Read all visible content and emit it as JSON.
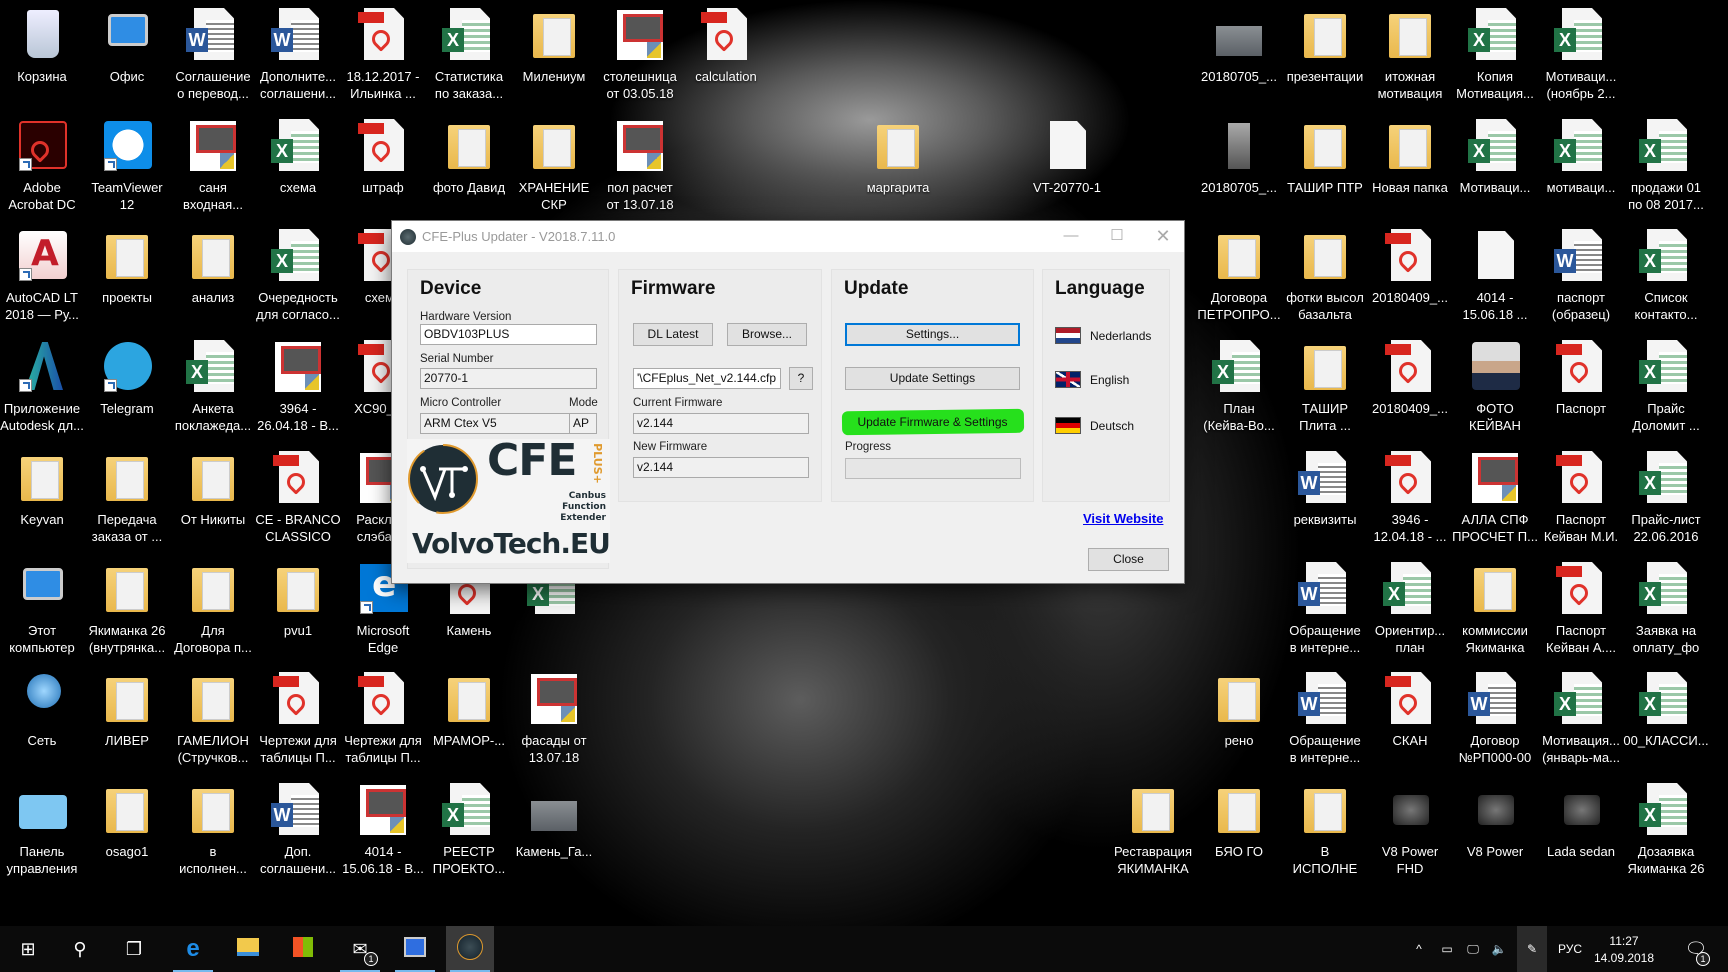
{
  "desktop": {
    "left_columns": [
      [
        {
          "label": "Корзина",
          "type": "recycle"
        },
        {
          "label": "Adobe\nAcrobat DC",
          "type": "acrobat-app"
        },
        {
          "label": "AutoCAD LT\n2018 — Ру...",
          "type": "autocad-app"
        },
        {
          "label": "Приложение\nAutodesk дл...",
          "type": "autodesk-app"
        },
        {
          "label": "Keyvan",
          "type": "user-folder"
        },
        {
          "label": "Этот\nкомпьютер",
          "type": "computer"
        },
        {
          "label": "Сеть",
          "type": "network"
        },
        {
          "label": "Панель\nуправления",
          "type": "control-panel"
        }
      ],
      [
        {
          "label": "Офис",
          "type": "office-app"
        },
        {
          "label": "TeamViewer\n12",
          "type": "teamviewer-app"
        },
        {
          "label": "проекты",
          "type": "folder"
        },
        {
          "label": "Telegram",
          "type": "telegram-app"
        },
        {
          "label": "Передача\nзаказа от ...",
          "type": "folder"
        },
        {
          "label": "Якиманка 26\n(внутрянка...",
          "type": "folder"
        },
        {
          "label": "ЛИВЕР",
          "type": "folder"
        },
        {
          "label": "osago1",
          "type": "folder"
        }
      ],
      [
        {
          "label": "Соглашение\nо перевод...",
          "type": "word"
        },
        {
          "label": "саня\nвходная...",
          "type": "dwg"
        },
        {
          "label": "анализ",
          "type": "folder"
        },
        {
          "label": "Анкета\nпоклажеда...",
          "type": "excel"
        },
        {
          "label": "От Никиты",
          "type": "folder"
        },
        {
          "label": "Для\nДоговора п...",
          "type": "folder"
        },
        {
          "label": "ГАМЕЛИОН\n(Стручков...",
          "type": "folder"
        },
        {
          "label": "в\nисполнен...",
          "type": "folder"
        }
      ],
      [
        {
          "label": "Дополните...\nсоглашени...",
          "type": "word"
        },
        {
          "label": "схема",
          "type": "excel"
        },
        {
          "label": "Очередность\nдля согласо...",
          "type": "excel"
        },
        {
          "label": "3964 -\n26.04.18 - В...",
          "type": "dwg"
        },
        {
          "label": "CE - BRANCO\nCLASSICO",
          "type": "pdf"
        },
        {
          "label": "pvu1",
          "type": "folder"
        },
        {
          "label": "Чертежи для\nтаблицы П...",
          "type": "pdf"
        },
        {
          "label": "Доп.\nсоглашени...",
          "type": "word"
        }
      ],
      [
        {
          "label": "18.12.2017 -\nИльинка ...",
          "type": "pdf"
        },
        {
          "label": "штраф",
          "type": "pdf"
        },
        {
          "label": "схема",
          "type": "pdf"
        },
        {
          "label": "XC90_o...",
          "type": "pdf"
        },
        {
          "label": "Раскла...\nслэбах...",
          "type": "dwg"
        },
        {
          "label": "Microsoft\nEdge",
          "type": "edge-app"
        },
        {
          "label": "Чертежи для\nтаблицы П...",
          "type": "pdf"
        },
        {
          "label": "4014 -\n15.06.18 - В...",
          "type": "dwg"
        }
      ],
      [
        {
          "label": "Статистика\nпо заказа...",
          "type": "excel"
        },
        {
          "label": "фото Давид",
          "type": "folder"
        },
        null,
        null,
        null,
        {
          "label": "Камень",
          "type": "pdf"
        },
        {
          "label": "МРАМОР-...",
          "type": "folder"
        },
        {
          "label": "РЕЕСТР\nПРОЕКТО...",
          "type": "excel"
        }
      ],
      [
        {
          "label": "Милениум",
          "type": "folder"
        },
        {
          "label": "ХРАНЕНИЕ\nСКР",
          "type": "folder"
        },
        null,
        null,
        null,
        {
          "label": "",
          "type": "excel"
        },
        {
          "label": "фасады от\n13.07.18",
          "type": "dwg"
        },
        {
          "label": "Камень_Га...",
          "type": "image"
        }
      ],
      [
        {
          "label": "столешница\nот 03.05.18",
          "type": "dwg"
        },
        {
          "label": "пол расчет\nот 13.07.18",
          "type": "dwg"
        }
      ],
      [
        {
          "label": "calculation",
          "type": "pdf"
        }
      ]
    ],
    "middle_icons": [
      {
        "label": "маргарита",
        "type": "folder"
      },
      {
        "label": "VT-20770-1",
        "type": "blank"
      }
    ],
    "right_columns": [
      [
        null,
        null,
        null,
        null,
        null,
        null,
        null,
        {
          "label": "Реставрация\nЯКИМАНКА",
          "type": "folder"
        }
      ],
      [
        {
          "label": "20180705_...",
          "type": "image"
        },
        {
          "label": "20180705_...",
          "type": "image-tall"
        },
        {
          "label": "Договора\nПЕТРОПРО...",
          "type": "folder"
        },
        {
          "label": "План\n(Кейва-Во...",
          "type": "excel"
        },
        null,
        null,
        {
          "label": "рено",
          "type": "folder"
        },
        {
          "label": "БЯО ГО",
          "type": "folder"
        }
      ],
      [
        {
          "label": "презентации",
          "type": "folder"
        },
        {
          "label": "ТАШИР ПТР",
          "type": "folder"
        },
        {
          "label": "фотки высол\nбазальта",
          "type": "folder"
        },
        {
          "label": "ТАШИР\nПлита ...",
          "type": "folder"
        },
        {
          "label": "реквизиты",
          "type": "word"
        },
        {
          "label": "Обращение\nв интерне...",
          "type": "word"
        },
        {
          "label": "Обращение\nв интерне...",
          "type": "word"
        },
        {
          "label": "В\nИСПОЛНЕ",
          "type": "folder"
        }
      ],
      [
        {
          "label": "итожная\nмотивация",
          "type": "folder"
        },
        {
          "label": "Новая папка",
          "type": "folder"
        },
        {
          "label": "20180409_...",
          "type": "pdf"
        },
        {
          "label": "20180409_...",
          "type": "pdf"
        },
        {
          "label": "3946 -\n12.04.18 - ...",
          "type": "pdf"
        },
        {
          "label": "Ориентир...\nплан",
          "type": "excel"
        },
        {
          "label": "СКАН",
          "type": "pdf"
        },
        {
          "label": "V8 Power\nFHD",
          "type": "video"
        }
      ],
      [
        {
          "label": "Копия\nМотивация...",
          "type": "excel"
        },
        {
          "label": "Мотиваци...",
          "type": "excel"
        },
        {
          "label": "4014 -\n15.06.18 ...",
          "type": "blank"
        },
        {
          "label": "ФОТО\nКЕЙВАН",
          "type": "photo"
        },
        {
          "label": "АЛЛА СПФ\nПРОСЧЕТ П...",
          "type": "dwg"
        },
        {
          "label": "коммиссии\nЯкиманка",
          "type": "folder"
        },
        {
          "label": "Договор\n№РП000-00",
          "type": "word"
        },
        {
          "label": "V8 Power",
          "type": "video"
        }
      ],
      [
        {
          "label": "Мотиваци...\n(ноябрь 2...",
          "type": "excel"
        },
        {
          "label": "мотиваци...",
          "type": "excel"
        },
        {
          "label": "паспорт\n(образец)",
          "type": "word"
        },
        {
          "label": "Паспорт",
          "type": "pdf"
        },
        {
          "label": "Паспорт\nКейван М.И.",
          "type": "pdf"
        },
        {
          "label": "Паспорт\nКейван А....",
          "type": "pdf"
        },
        {
          "label": "Мотивация...\n(январь-ма...",
          "type": "excel"
        },
        {
          "label": "Lada sedan",
          "type": "video"
        }
      ],
      [
        null,
        {
          "label": "продажи 01\nпо 08 2017...",
          "type": "excel"
        },
        {
          "label": "Список\nконтакто...",
          "type": "excel"
        },
        {
          "label": "Прайс\nДоломит ...",
          "type": "excel"
        },
        {
          "label": "Прайс-лист\n22.06.2016",
          "type": "excel"
        },
        {
          "label": "Заявка на\nоплату_фо",
          "type": "excel"
        },
        {
          "label": "00_КЛАССИ...",
          "type": "excel"
        },
        {
          "label": "Дозаявка\nЯкиманка 26",
          "type": "excel"
        }
      ]
    ]
  },
  "dialog": {
    "title": "CFE-Plus Updater - V2018.7.11.0",
    "device": {
      "title": "Device",
      "hardware_version_label": "Hardware Version",
      "hardware_version": "OBDV103PLUS",
      "serial_number_label": "Serial Number",
      "serial_number": "20770-1",
      "micro_controller_label": "Micro Controller",
      "micro_controller": "ARM Ctex V5",
      "mode_label": "Mode",
      "mode": "AP"
    },
    "firmware": {
      "title": "Firmware",
      "dl_latest": "DL Latest",
      "browse": "Browse...",
      "file": "'\\CFEplus_Net_v2.144.cfp",
      "help": "?",
      "current_label": "Current Firmware",
      "current": "v2.144",
      "new_label": "New Firmware",
      "new": "v2.144"
    },
    "update": {
      "title": "Update",
      "settings": "Settings...",
      "update_settings": "Update Settings",
      "update_firmware_settings": "Update Firmware & Settings",
      "progress_label": "Progress",
      "progress": 0
    },
    "language": {
      "title": "Language",
      "items": [
        {
          "label": "Nederlands",
          "flag": "nl"
        },
        {
          "label": "English",
          "flag": "gb"
        },
        {
          "label": "Deutsch",
          "flag": "de"
        }
      ]
    },
    "logo": {
      "brand": "CFE",
      "plus": "PLUS+",
      "tagline": "Canbus Function Extender",
      "site": "VolvoTech.EU"
    },
    "visit_website": "Visit Website",
    "close": "Close",
    "highlight_color": "#26e01c",
    "link_color": "#0000ee"
  },
  "taskbar": {
    "apps": [
      {
        "name": "start",
        "icon": "windows-icon"
      },
      {
        "name": "search",
        "icon": "search-icon"
      },
      {
        "name": "task-view",
        "icon": "task-view-icon"
      },
      {
        "name": "edge",
        "icon": "edge-icon",
        "running": true
      },
      {
        "name": "file-explorer",
        "icon": "folder-icon"
      },
      {
        "name": "store",
        "icon": "store-icon"
      },
      {
        "name": "mail",
        "icon": "mail-icon",
        "running": true,
        "badge": "1"
      },
      {
        "name": "office",
        "icon": "computer-icon",
        "running": true
      },
      {
        "name": "cfe-updater",
        "icon": "vt-icon",
        "running": true,
        "active": true
      }
    ],
    "language": "РУС",
    "time": "11:27",
    "date": "14.09.2018",
    "notification_badge": "1"
  }
}
